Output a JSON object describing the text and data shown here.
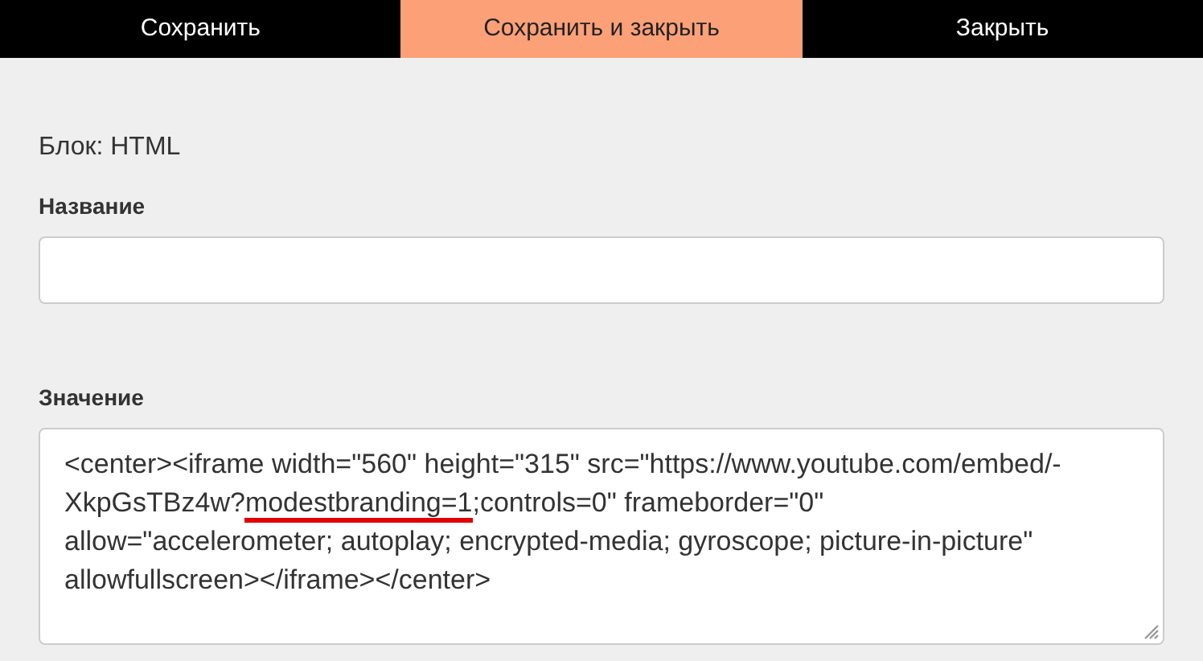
{
  "toolbar": [
    {
      "label": "Сохранить",
      "selected": false
    },
    {
      "label": "Сохранить и закрыть",
      "selected": true
    },
    {
      "label": "Закрыть",
      "selected": false
    }
  ],
  "block_type": "Блок: HTML",
  "fields": [
    {
      "kind": "input",
      "label": "Название"
    },
    {
      "kind": "textarea",
      "label": "Значение",
      "value_parts": [
        {
          "text": "<center><iframe width=\"560\" height=\"315\" src=\"https://www.youtube.com/embed/-XkpGsTBz4w?",
          "underlined": false
        },
        {
          "text": "modestbranding=1",
          "underlined": true
        },
        {
          "text": ";controls=0\" frameborder=\"0\" allow=\"accelerometer; autoplay; encrypted-media; gyroscope; picture-in-picture\" allowfullscreen></iframe></center>",
          "underlined": false
        }
      ]
    }
  ]
}
